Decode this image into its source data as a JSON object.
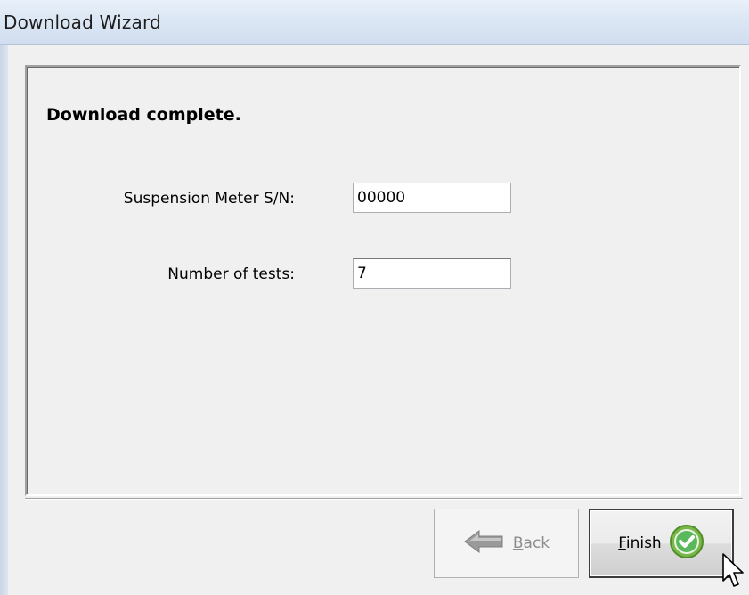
{
  "window": {
    "title": "Download Wizard"
  },
  "page": {
    "heading": "Download complete.",
    "fields": [
      {
        "label": "Suspension Meter S/N:",
        "value": "00000"
      },
      {
        "label": "Number of tests:",
        "value": "7"
      }
    ]
  },
  "buttons": {
    "back": {
      "mnemonic": "B",
      "rest": "ack",
      "enabled": false,
      "icon": "left-arrow-icon"
    },
    "finish": {
      "mnemonic": "F",
      "rest": "inish",
      "enabled": true,
      "icon": "check-circle-icon"
    }
  },
  "colors": {
    "finish_icon": "#5cb85c",
    "back_icon_disabled": "#9a9a9a"
  }
}
